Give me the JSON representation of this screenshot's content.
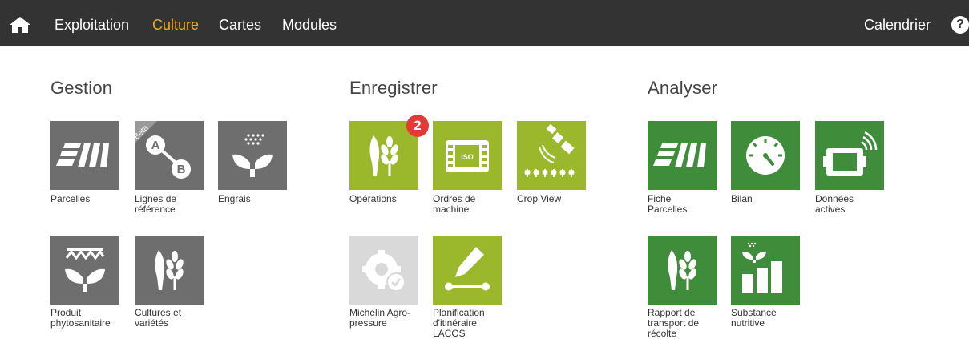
{
  "nav": {
    "items": [
      "Exploitation",
      "Culture",
      "Cartes",
      "Modules"
    ],
    "active": "Culture",
    "calendar": "Calendrier",
    "help": "?"
  },
  "colors": {
    "topbar": "#333333",
    "active_nav": "#f5a623",
    "gray_tile": "#6e6e6e",
    "lime_tile": "#9bb82c",
    "dark_green_tile": "#3f8c3b",
    "disabled_tile": "#d9d9d9",
    "badge": "#e53935"
  },
  "sections": {
    "gestion": {
      "title": "Gestion",
      "tiles": [
        {
          "label": "Parcelles",
          "icon": "parcels-icon"
        },
        {
          "label": "Lignes de référence",
          "label_lines": [
            "Lignes de",
            "référence"
          ],
          "icon": "ab-line-icon",
          "beta": "Beta"
        },
        {
          "label": "Engrais",
          "icon": "fertilizer-icon"
        },
        {
          "label": "Produit phytosanitaire",
          "label_lines": [
            "Produit",
            "phytosanitaire"
          ],
          "icon": "plant-protection-icon"
        },
        {
          "label": "Cultures et variétés",
          "label_lines": [
            "Cultures et",
            "variétés"
          ],
          "icon": "crops-icon"
        }
      ]
    },
    "enregistrer": {
      "title": "Enregistrer",
      "tiles": [
        {
          "label": "Opérations",
          "icon": "crops-icon",
          "badge": "2"
        },
        {
          "label": "Ordres de machine",
          "label_lines": [
            "Ordres de",
            "machine"
          ],
          "icon": "iso-terminal-icon"
        },
        {
          "label": "Crop View",
          "icon": "satellite-icon"
        },
        {
          "label": "Michelin Agro-pressure",
          "label_lines": [
            "Michelin Agro-",
            "pressure"
          ],
          "icon": "tire-pressure-icon",
          "disabled": true
        },
        {
          "label": "Planification d'itinéraire LACOS",
          "label_lines": [
            "Planification",
            "d'itinéraire",
            "LACOS"
          ],
          "icon": "route-planning-icon"
        }
      ]
    },
    "analyser": {
      "title": "Analyser",
      "tiles": [
        {
          "label": "Fiche Parcelles",
          "label_lines": [
            "Fiche",
            "Parcelles"
          ],
          "icon": "parcels-icon"
        },
        {
          "label": "Bilan",
          "icon": "gauge-icon"
        },
        {
          "label": "Données actives",
          "label_lines": [
            "Données",
            "actives"
          ],
          "icon": "active-data-icon"
        },
        {
          "label": "Rapport de transport de récolte",
          "label_lines": [
            "Rapport de",
            "transport de",
            "récolte"
          ],
          "icon": "crops-icon"
        },
        {
          "label": "Substance nutritive",
          "label_lines": [
            "Substance",
            "nutritive"
          ],
          "icon": "nutrient-chart-icon"
        }
      ]
    }
  }
}
